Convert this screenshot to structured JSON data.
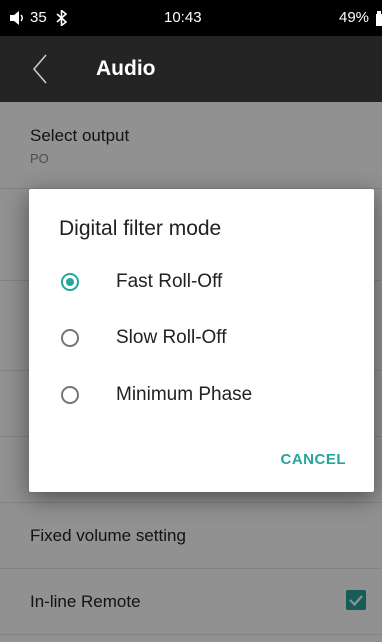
{
  "status_bar": {
    "volume_icon": "speaker-icon",
    "volume_value": "35",
    "bluetooth_icon": "bluetooth-icon",
    "time": "10:43",
    "battery": "49%",
    "battery_icon": "battery-icon"
  },
  "toolbar": {
    "back_icon": "back-arrow-icon",
    "title": "Audio"
  },
  "settings": {
    "select_output": {
      "title": "Select output",
      "value": "PO"
    },
    "fixed_volume": {
      "title": "Fixed volume setting"
    },
    "inline_remote": {
      "title": "In-line Remote",
      "checked": true
    }
  },
  "dialog": {
    "title": "Digital filter mode",
    "options": [
      {
        "label": "Fast Roll-Off",
        "selected": true
      },
      {
        "label": "Slow Roll-Off",
        "selected": false
      },
      {
        "label": "Minimum Phase",
        "selected": false
      }
    ],
    "cancel_label": "CANCEL"
  },
  "colors": {
    "accent": "#26a69a",
    "toolbar_bg": "#242424",
    "status_bar_bg": "#000000"
  }
}
